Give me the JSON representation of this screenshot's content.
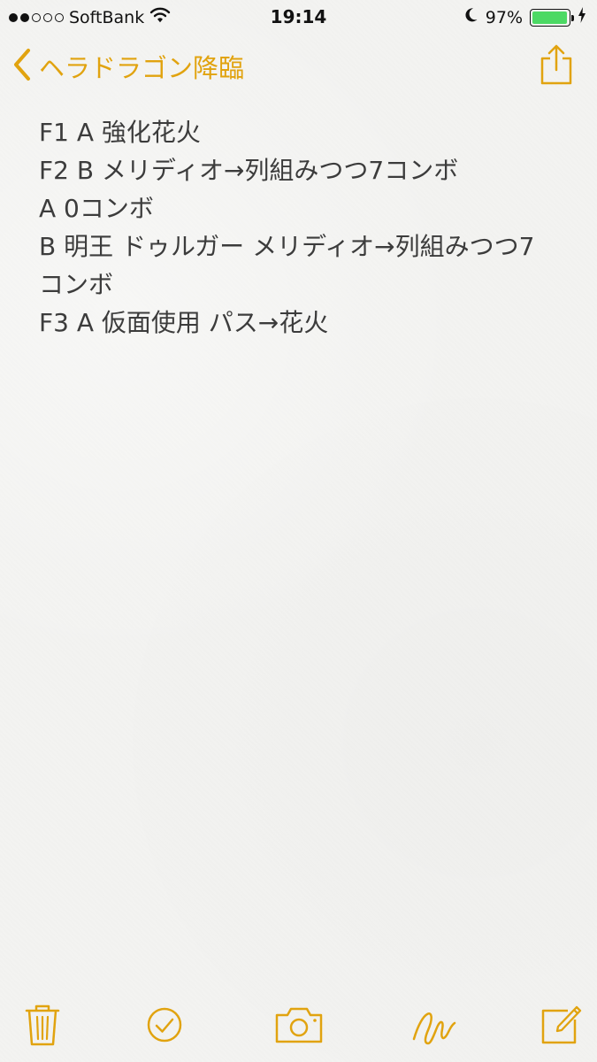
{
  "status_bar": {
    "carrier": "SoftBank",
    "time": "19:14",
    "battery_percent": "97%",
    "battery_level": 0.97,
    "signal_bars_filled": 2,
    "signal_bars_total": 5,
    "icons": [
      "wifi-icon",
      "moon-icon",
      "battery-icon",
      "charging-bolt-icon"
    ]
  },
  "nav": {
    "back_label": "ヘラドラゴン降臨",
    "icons": [
      "back-chevron-icon",
      "share-icon"
    ]
  },
  "note": {
    "lines": [
      "F1 A 強化花火",
      "F2 B メリディオ→列組みつつ7コンボ",
      "A 0コンボ",
      "B 明王 ドゥルガー メリディオ→列組みつつ7",
      "コンボ",
      "F3 A 仮面使用 パス→花火"
    ]
  },
  "toolbar": {
    "icons": [
      "trash-icon",
      "checkmark-icon",
      "camera-icon",
      "sketch-icon",
      "compose-icon"
    ]
  },
  "colors": {
    "accent": "#e1a30f",
    "text": "#3c3c3c",
    "background": "#f3f3f1",
    "battery": "#4cd964"
  }
}
